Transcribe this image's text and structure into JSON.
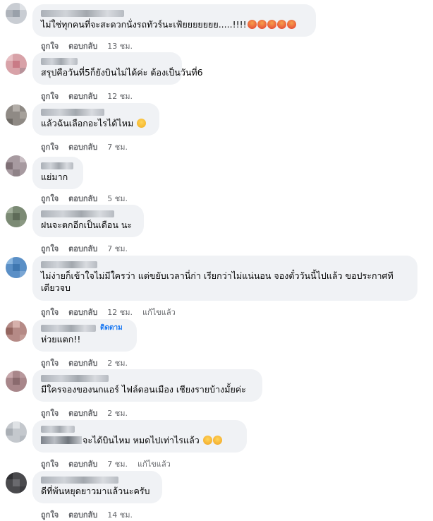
{
  "labels": {
    "like": "ถูกใจ",
    "reply": "ตอบกลับ",
    "edited": "แก้ไขแล้ว",
    "follow": "ติดตาม"
  },
  "comments": [
    {
      "text": "ไม่ใช่ทุกคนที่จะสะดวกนั่งรถทัวร์นะเฟ้ยยยยยยย.....!!!!",
      "time": "13 ชม.",
      "avatar_color": "#c9cdd3",
      "emoji": [
        "angry",
        "angry",
        "angry",
        "angry",
        "angry"
      ]
    },
    {
      "text": "สรุปคือวันที่5ก็ยังบินไม่ได้ค่ะ ต้องเป็นวันที่6",
      "time": "12 ชม.",
      "avatar_color": "#d8a2a8"
    },
    {
      "text": "แล้วฉันเลือกอะไรได้ไหม",
      "time": "7 ชม.",
      "avatar_color": "#8f8a85",
      "emoji": [
        "weary"
      ]
    },
    {
      "text": "แย่มาก",
      "time": "5 ชม.",
      "avatar_color": "#a79aa0"
    },
    {
      "text": "ฝนจะตกอีกเป็นเดือน นะ",
      "time": "7 ชม.",
      "avatar_color": "#7b8a74"
    },
    {
      "text": "ไม่ง่ายก็เข้าใจไม่มีใครว่า แต่ขยับเวลานี่ก่า เรียกว่าไม่แน่นอน จองตั๋ววันนี้ไปแล้ว ขอประกาศทีเดียวจบ",
      "time": "12 ชม.",
      "edited": true,
      "avatar_color": "#5a8fc6"
    },
    {
      "text": "ห่วยแตก!!",
      "time": "2 ชม.",
      "follow": true,
      "avatar_color": "#b58a86"
    },
    {
      "text": "มีใครจองของนกแอร์ ไฟล์ดอนเมือง เชียงรายบ้างมั้ยค่ะ",
      "time": "2 ชม.",
      "avatar_color": "#a8868a"
    },
    {
      "text": "จะได้บินไหม หมดไปเท่าไรแล้ว",
      "time": "7 ชม.",
      "edited": true,
      "avatar_color": "#c4c8cd",
      "emoji": [
        "confused",
        "confused"
      ]
    },
    {
      "text": "ดีที่พ้นหยุดยาวมาแล้วนะครับ",
      "time": "14 ชม.",
      "avatar_color": "#4a4a4d"
    }
  ]
}
